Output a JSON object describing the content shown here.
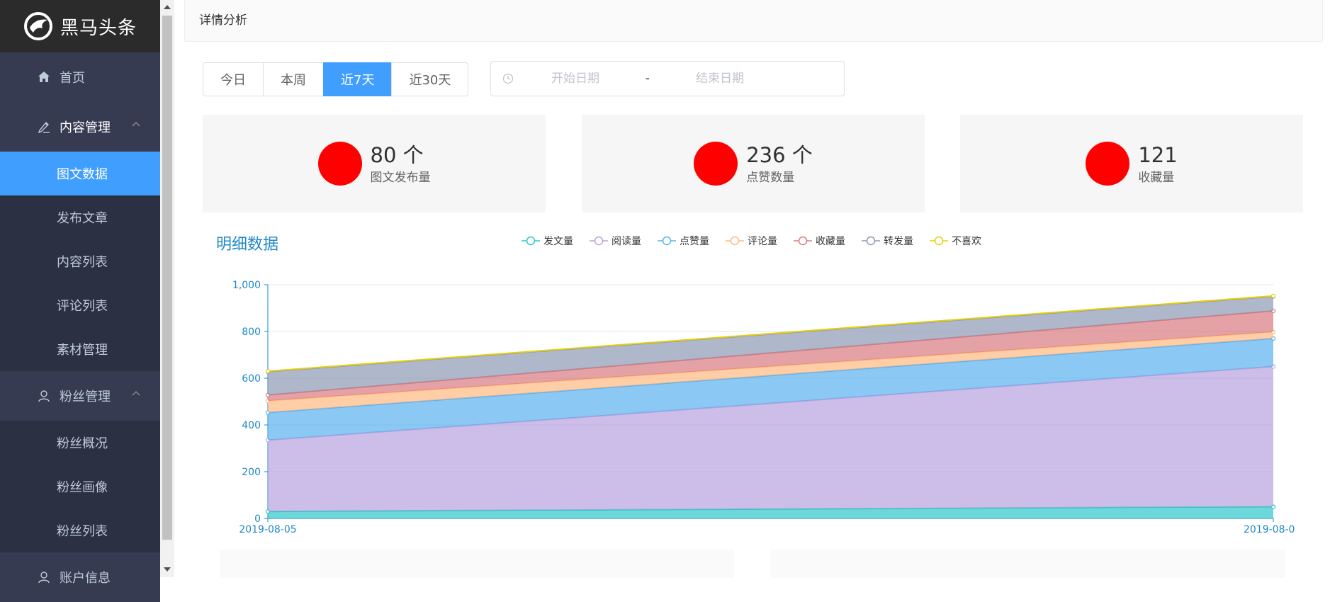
{
  "app": {
    "logo_text": "黑马头条"
  },
  "sidebar": {
    "items": [
      {
        "label": "首页",
        "icon": "home-icon"
      },
      {
        "label": "内容管理",
        "icon": "edit-icon",
        "expanded": true,
        "children": [
          "图文数据",
          "发布文章",
          "内容列表",
          "评论列表",
          "素材管理"
        ]
      },
      {
        "label": "粉丝管理",
        "icon": "user-icon",
        "expanded": true,
        "children": [
          "粉丝概况",
          "粉丝画像",
          "粉丝列表"
        ]
      },
      {
        "label": "账户信息",
        "icon": "user-icon"
      }
    ],
    "active_child": "图文数据",
    "active_color": "#409eff"
  },
  "header": {
    "title": "详情分析"
  },
  "filters": {
    "ranges": [
      "今日",
      "本周",
      "近7天",
      "近30天"
    ],
    "active_range": "近7天",
    "start_placeholder": "开始日期",
    "end_placeholder": "结束日期",
    "separator": "-"
  },
  "stats": [
    {
      "value": "80 个",
      "label": "图文发布量"
    },
    {
      "value": "236 个",
      "label": "点赞数量"
    },
    {
      "value": "121",
      "label": "收藏量"
    }
  ],
  "chart_data": {
    "type": "area",
    "title": "明细数据",
    "stacked": true,
    "x": [
      "2019-08-05",
      "2019-08-0"
    ],
    "ylim": [
      0,
      1000
    ],
    "yticks": [
      "0",
      "200",
      "400",
      "600",
      "800",
      "1,000"
    ],
    "grid": true,
    "legend_position": "top-center",
    "series": [
      {
        "name": "发文量",
        "color": "#2ec7c9",
        "values": [
          30,
          50
        ]
      },
      {
        "name": "阅读量",
        "color": "#b6a2de",
        "values": [
          305,
          600
        ]
      },
      {
        "name": "点赞量",
        "color": "#5ab1ef",
        "values": [
          118,
          120
        ]
      },
      {
        "name": "评论量",
        "color": "#ffb980",
        "values": [
          50,
          28
        ]
      },
      {
        "name": "收藏量",
        "color": "#d87a80",
        "values": [
          25,
          90
        ]
      },
      {
        "name": "转发量",
        "color": "#8d98b3",
        "values": [
          100,
          62
        ]
      },
      {
        "name": "不喜欢",
        "color": "#e5cf0d",
        "values": [
          2,
          2
        ]
      }
    ]
  }
}
